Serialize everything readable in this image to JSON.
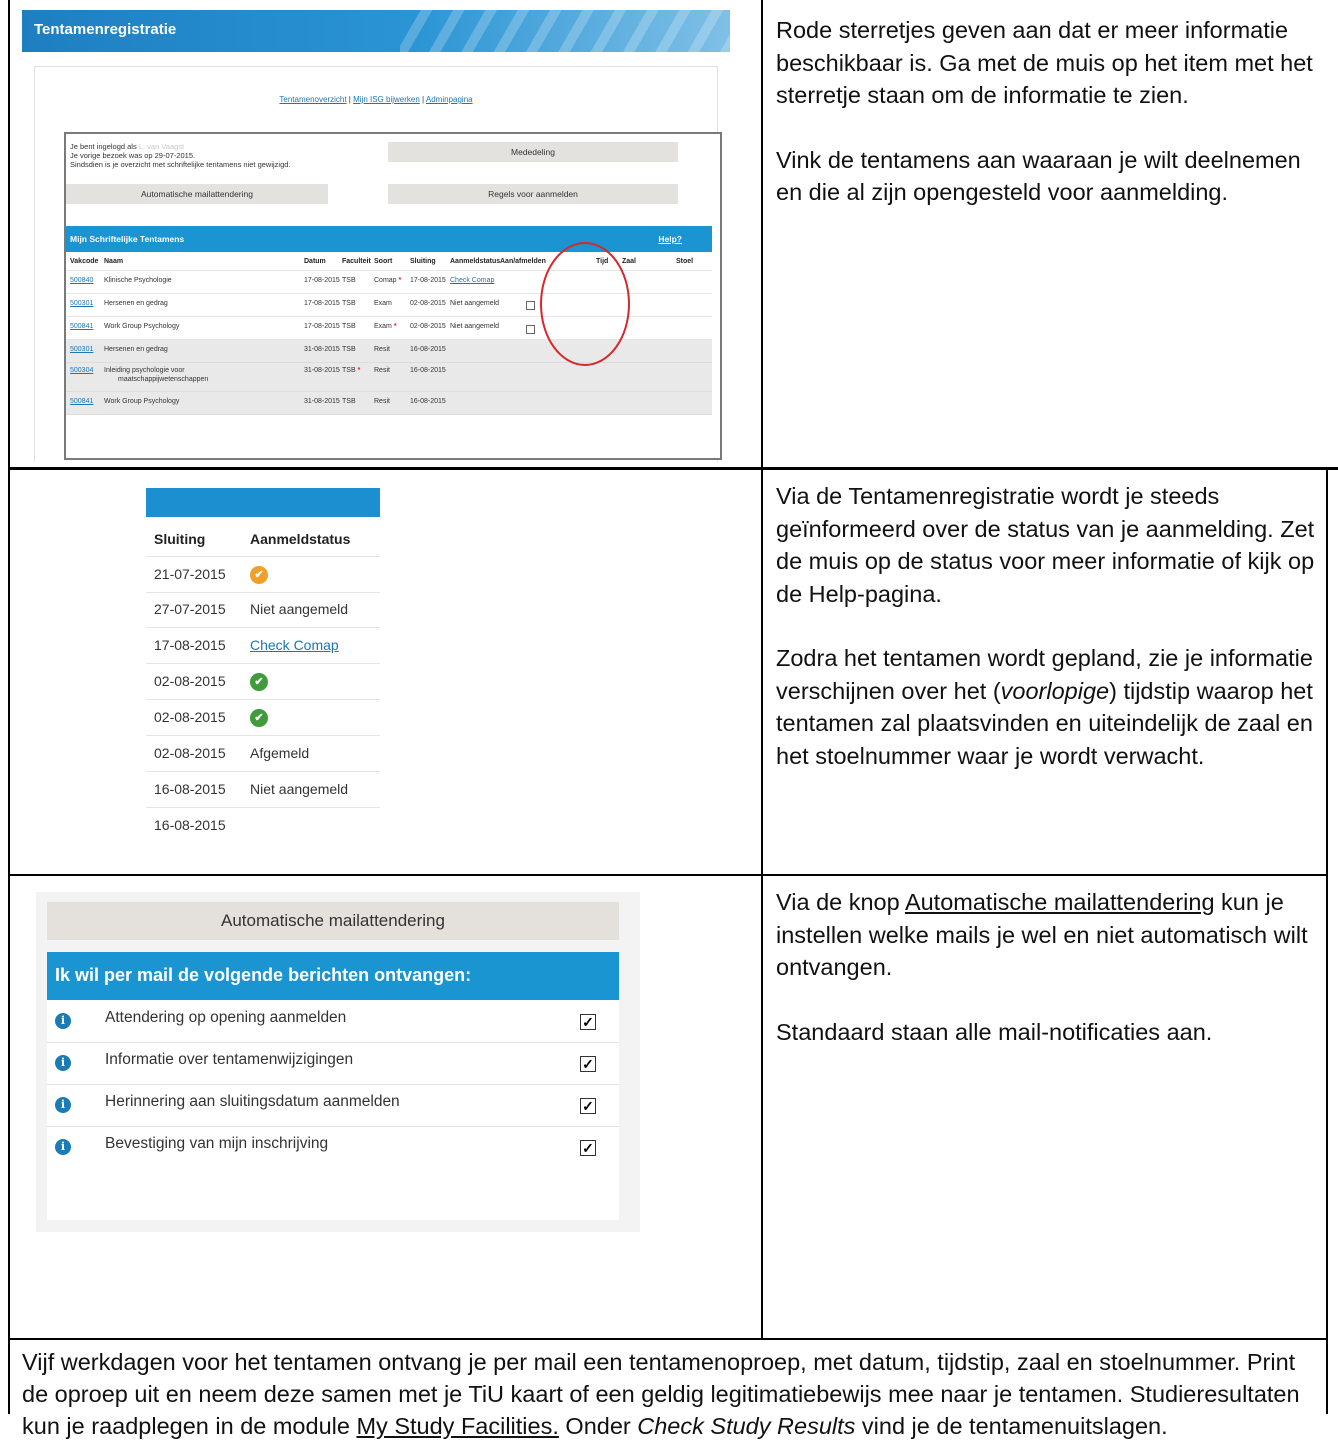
{
  "shot1": {
    "title": "Tentamenregistratie",
    "nav": {
      "link1": "Tentamenoverzicht",
      "link2": "Mijn ISG bijwerken",
      "link3": "Adminpagina",
      "separator": "|"
    },
    "login": {
      "line1": "Je bent ingelogd als",
      "name": "L. van Vaagst",
      "line2": "Je vorige bezoek was op 29-07-2015.",
      "line3": "Sindsdien is je overzicht met schriftelijke tentamens niet gewijzigd."
    },
    "buttons": {
      "mededeling": "Mededeling",
      "mail": "Automatische mailattendering",
      "regels": "Regels voor aanmelden"
    },
    "table": {
      "title": "Mijn Schriftelijke Tentamens",
      "help": "Help?",
      "columns": [
        "Vakcode",
        "Naam",
        "Datum",
        "Faculteit",
        "Soort",
        "Sluiting",
        "Aanmeldstatus",
        "Aan/afmelden",
        "Tijd",
        "Zaal",
        "Stoel"
      ],
      "rows": [
        {
          "code": "500840",
          "naam": "Klinische Psychologie",
          "datum": "17-08-2015",
          "fac": "TSB",
          "soort": "Comap",
          "sluiting": "17-08-2015",
          "status": "Check Comap"
        },
        {
          "code": "500301",
          "naam": "Hersenen en gedrag",
          "datum": "17-08-2015",
          "fac": "TSB",
          "soort": "Exam",
          "sluiting": "02-08-2015",
          "status": "Niet aangemeld"
        },
        {
          "code": "500841",
          "naam": "Work Group Psychology",
          "datum": "17-08-2015",
          "fac": "TSB",
          "soort": "Exam",
          "sluiting": "02-08-2015",
          "status": "Niet aangemeld"
        },
        {
          "code": "500301",
          "naam": "Hersenen en gedrag",
          "datum": "31-08-2015",
          "fac": "TSB",
          "soort": "Resit",
          "sluiting": "16-08-2015",
          "status": ""
        },
        {
          "code": "500304",
          "naam": "Inleiding psychologie voor",
          "naam2": "maatschappijwetenschappen",
          "datum": "31-08-2015",
          "fac": "TSB",
          "soort": "Resit",
          "sluiting": "16-08-2015",
          "status": ""
        },
        {
          "code": "500841",
          "naam": "Work Group Psychology",
          "datum": "31-08-2015",
          "fac": "TSB",
          "soort": "Resit",
          "sluiting": "16-08-2015",
          "status": ""
        }
      ],
      "star": "*"
    }
  },
  "text1": {
    "p1": "Rode sterretjes geven aan dat er meer informatie beschikbaar is. Ga met de muis op het item met het sterretje staan om de informatie te zien.",
    "p2": "Vink de tentamens aan waaraan je wilt deelnemen en die al zijn opengesteld voor aanmelding."
  },
  "shot2": {
    "headers": [
      "Sluiting",
      "Aanmeldstatus"
    ],
    "rows": [
      {
        "date": "21-07-2015",
        "status": "",
        "icon": "orange-check-icon"
      },
      {
        "date": "27-07-2015",
        "status": "Niet aangemeld"
      },
      {
        "date": "17-08-2015",
        "status": "Check Comap"
      },
      {
        "date": "02-08-2015",
        "status": "",
        "icon": "green-check-icon"
      },
      {
        "date": "02-08-2015",
        "status": "",
        "icon": "green-check-icon"
      },
      {
        "date": "02-08-2015",
        "status": "Afgemeld"
      },
      {
        "date": "16-08-2015",
        "status": "Niet aangemeld"
      },
      {
        "date": "16-08-2015",
        "status": ""
      }
    ]
  },
  "text2": {
    "p1": "Via de Tentamenregistratie wordt je steeds geïnformeerd over de status van je aanmelding. Zet de muis op de status voor meer informatie of kijk op de Help-pagina.",
    "p2a": "Zodra het tentamen wordt gepland, zie je informatie verschijnen over het (",
    "p2em": "voorlopige",
    "p2b": ") tijdstip waarop het tentamen zal plaatsvinden en uiteindelijk de zaal en het stoelnummer waar je wordt verwacht."
  },
  "shot3": {
    "button": "Automatische mailattendering",
    "heading": "Ik wil per mail de volgende berichten ontvangen:",
    "items": [
      {
        "label": "Attendering op opening aanmelden",
        "checked": true
      },
      {
        "label": "Informatie over tentamenwijzigingen",
        "checked": true
      },
      {
        "label": "Herinnering aan sluitingsdatum aanmelden",
        "checked": true
      },
      {
        "label": "Bevestiging van mijn inschrijving",
        "checked": true
      }
    ],
    "check_glyph": "✓"
  },
  "text3": {
    "link": "Automatische mailattendering",
    "intro": "Via de knop ",
    "p1b": " kun je instellen welke mails je wel en niet automatisch wilt ontvangen.",
    "p2": "Standaard staan alle mail-notificaties aan."
  },
  "footer": {
    "a": "Vijf werkdagen voor het tentamen ontvang je per mail een tentamenoproep, met datum, tijdstip, zaal en stoelnummer. Print de oproep uit en neem deze samen met je TiU kaart of een geldig legitimatiebewijs mee naar je tentamen. Studieresultaten kun je raadplegen in de module ",
    "link": "My Study Facilities.",
    "b": " Onder ",
    "em": "Check Study Results",
    "c": " vind je de tentamenuitslagen."
  }
}
